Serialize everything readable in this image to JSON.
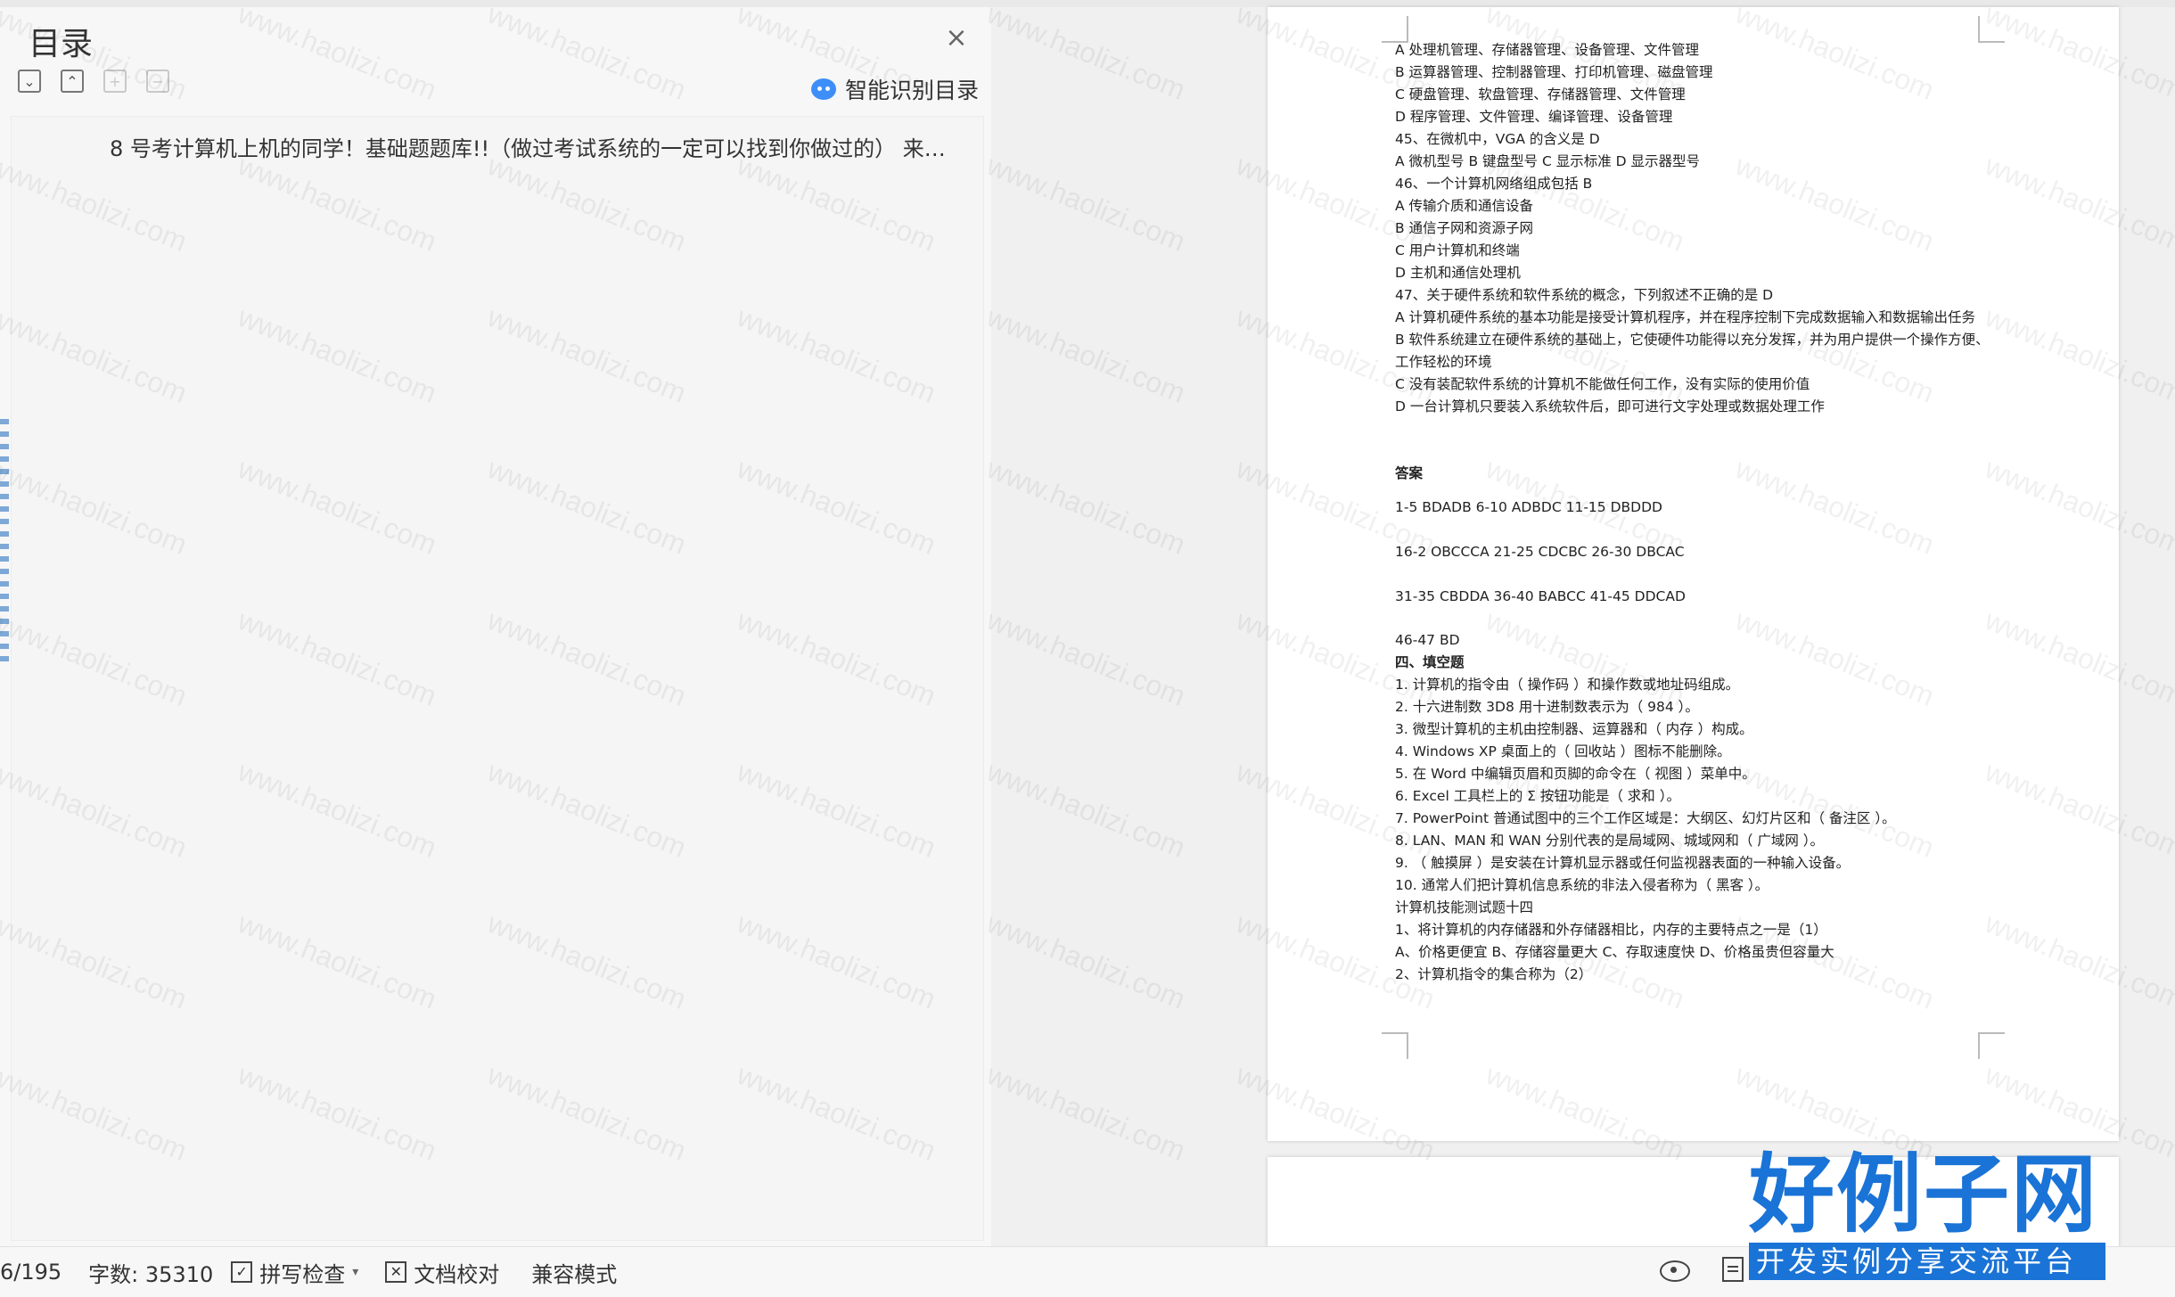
{
  "toc": {
    "title": "目录",
    "close_icon": "×",
    "smart_toc_label": "智能识别目录",
    "items": [
      "8 号考计算机上机的同学！基础题题库!!（做过考试系统的一定可以找到你做过的） 来…"
    ]
  },
  "watermark": "www.haolizi.com",
  "document": {
    "lines": [
      "A 处理机管理、存储器管理、设备管理、文件管理",
      "B 运算器管理、控制器管理、打印机管理、磁盘管理",
      "C 硬盘管理、软盘管理、存储器管理、文件管理",
      "D 程序管理、文件管理、编译管理、设备管理",
      "45、在微机中，VGA 的含义是 D",
      "A 微机型号 B 键盘型号 C 显示标准 D 显示器型号",
      "46、一个计算机网络组成包括 B",
      "A 传输介质和通信设备",
      "B 通信子网和资源子网",
      "C 用户计算机和终端",
      "D 主机和通信处理机",
      "47、关于硬件系统和软件系统的概念，下列叙述不正确的是 D",
      "A 计算机硬件系统的基本功能是接受计算机程序，并在程序控制下完成数据输入和数据输出任务",
      "B 软件系统建立在硬件系统的基础上，它使硬件功能得以充分发挥，并为用户提供一个操作方便、工作轻松的环境",
      "C 没有装配软件系统的计算机不能做任何工作，没有实际的使用价值",
      "D 一台计算机只要装入系统软件后，即可进行文字处理或数据处理工作"
    ],
    "answer_heading": "答案",
    "answers": [
      "1-5 BDADB   6-10 ADBDC   11-15 DBDDD",
      "16-2 OBCCCA  21-25 CDCBC  26-30 DBCAC",
      "31-35 CBDDA  36-40 BABCC  41-45 DDCAD",
      "46-47 BD"
    ],
    "section_heading": "四、填空题",
    "fill_lines": [
      "1. 计算机的指令由（ 操作码 ）和操作数或地址码组成。",
      "2. 十六进制数 3D8 用十进制数表示为（   984   ）。",
      "3. 微型计算机的主机由控制器、运算器和（   内存   ）构成。",
      "4. Windows XP 桌面上的（   回收站   ）图标不能删除。",
      "5. 在 Word 中编辑页眉和页脚的命令在（   视图   ）菜单中。",
      "6. Excel 工具栏上的 Σ 按钮功能是（   求和   ）。",
      "7. PowerPoint 普通试图中的三个工作区域是：大纲区、幻灯片区和（   备注区   ）。",
      "8. LAN、MAN 和 WAN 分别代表的是局域网、城域网和（   广域网   ）。",
      "9. （   触摸屏   ）是安装在计算机显示器或任何监视器表面的一种输入设备。",
      "10. 通常人们把计算机信息系统的非法入侵者称为（   黑客   ）。",
      "计算机技能测试题十四",
      "1、将计算机的内存储器和外存储器相比，内存的主要特点之一是（1）",
      "A、价格更便宜  B、存储容量更大 C、存取速度快  D、价格虽贵但容量大",
      "2、计算机指令的集合称为（2）"
    ]
  },
  "status": {
    "page": "6/195",
    "word_count": "字数: 35310",
    "spell_check": "拼写检查",
    "doc_proof": "文档校对",
    "compat_mode": "兼容模式"
  },
  "logo": {
    "main": "好例子网",
    "sub": "开发实例分享交流平台"
  },
  "colors": {
    "logo_blue": "#1a73d6",
    "smart_icon": "#3e8ef7"
  }
}
